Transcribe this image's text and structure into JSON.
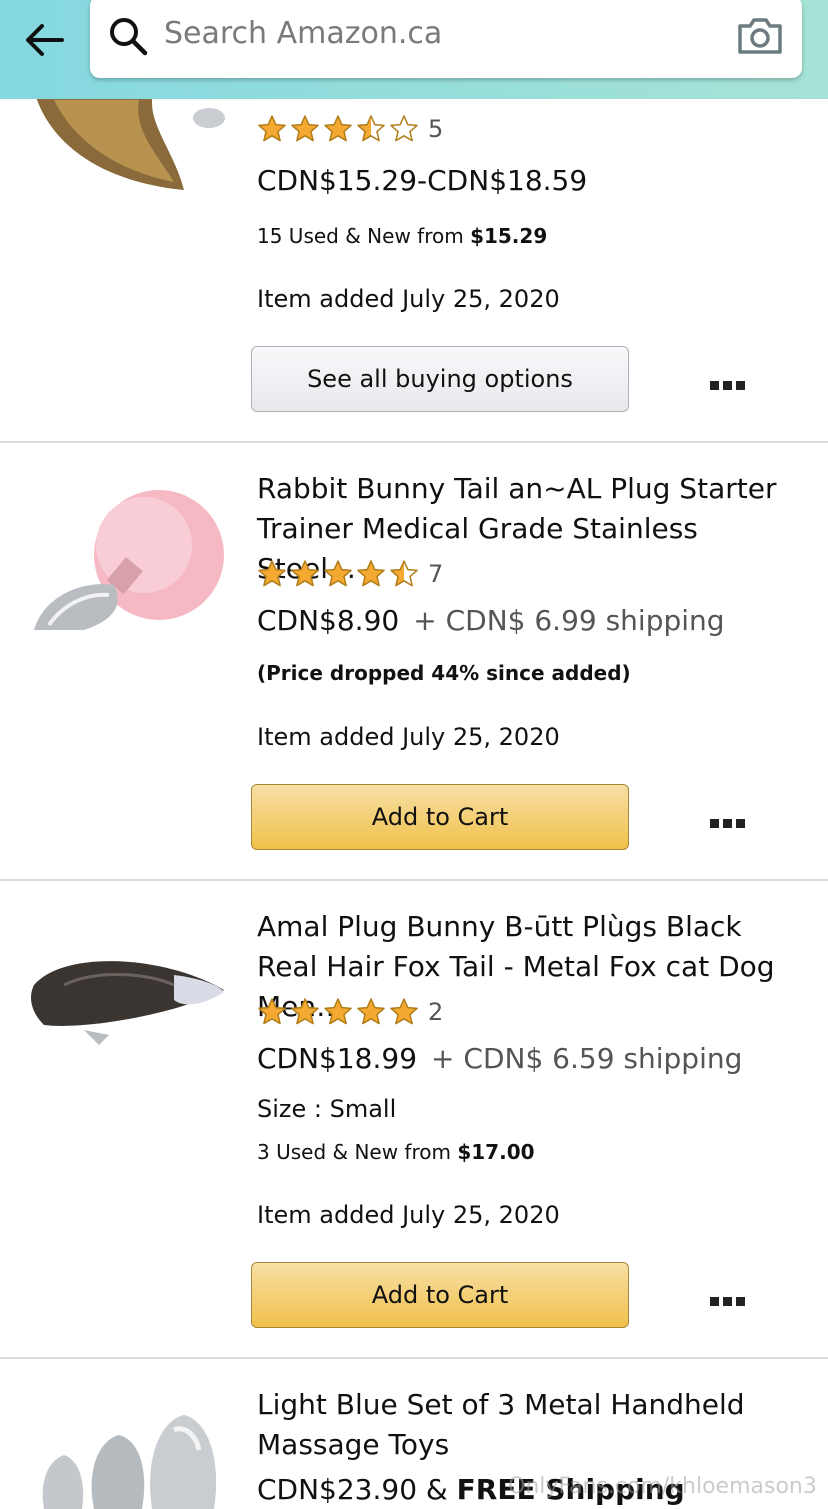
{
  "search": {
    "placeholder": "Search Amazon.ca",
    "icons": [
      "back-arrow-icon",
      "search-icon",
      "camera-icon"
    ]
  },
  "items": [
    {
      "rating": 3.5,
      "rating_count": "5",
      "price": "CDN$15.29-CDN$18.59",
      "offers_prefix": "15 Used & New  from ",
      "offers_price": "$15.29",
      "added": "Item added July 25, 2020",
      "button": "See all buying options"
    },
    {
      "title": "Rabbit Bunny Tail an~AL Plug Starter Trainer Medical Grade Stainless Steel…",
      "rating": 4.5,
      "rating_count": "7",
      "price": "CDN$8.90",
      "shipping": "+ CDN$ 6.99 shipping",
      "note": "(Price dropped 44% since added)",
      "added": "Item added July 25, 2020",
      "button": "Add to Cart"
    },
    {
      "title": "Amal Plug Bunny B-ūtt Plùgs Black Real Hair Fox Tail - Metal Fox cat Dog Men…",
      "rating": 5,
      "rating_count": "2",
      "price": "CDN$18.99",
      "shipping": "+ CDN$ 6.59 shipping",
      "size": "Size : Small",
      "offers_prefix": "3 Used & New  from ",
      "offers_price": "$17.00",
      "added": "Item added July 25, 2020",
      "button": "Add to Cart"
    },
    {
      "title": "Light Blue Set of 3 Metal Handheld Massage Toys",
      "price": "CDN$23.90 & ",
      "shipping_bold": "FREE Shipping"
    }
  ],
  "watermark": "OnlyFans.com/khloemason3",
  "colors": {
    "header": "#84d8e0",
    "star": "#f4a932",
    "button_yellow": "#f0c14b",
    "button_grey": "#e7e9ec"
  }
}
